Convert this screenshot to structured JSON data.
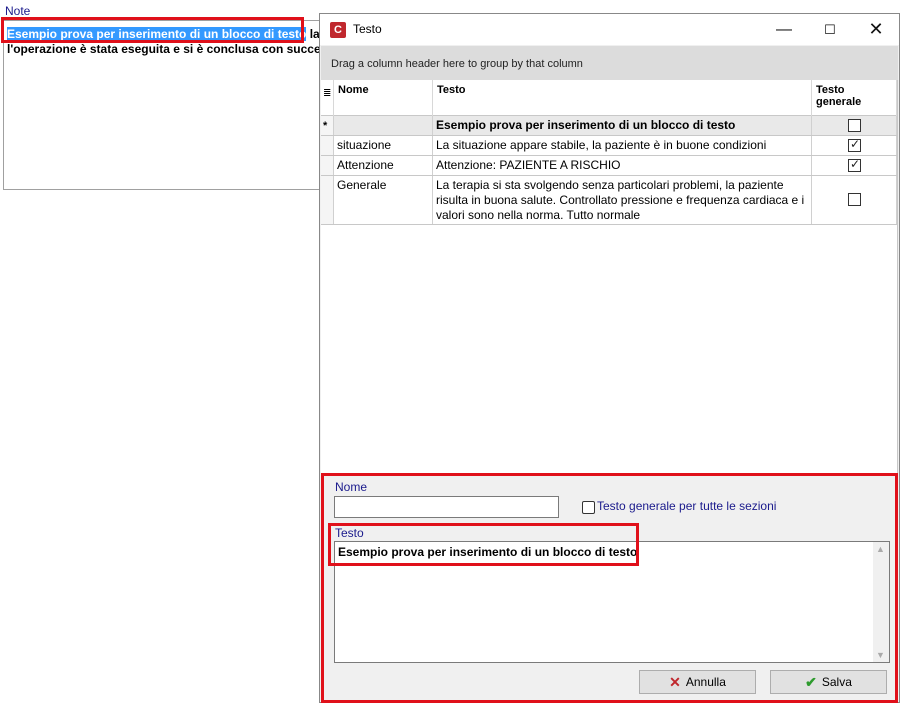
{
  "note": {
    "label": "Note",
    "line1_selected": "Esempio prova per inserimento di un blocco di testo",
    "line1_rest": " la",
    "line2": "l'operazione è stata eseguita e si è conclusa con succe"
  },
  "dialog": {
    "title": "Testo",
    "group_hint": "Drag a column header here to group by that column",
    "columns": {
      "nome": "Nome",
      "testo": "Testo",
      "generale": "Testo generale"
    },
    "new_row": {
      "indicator": "*",
      "nome": "",
      "testo": "Esempio prova per inserimento di un blocco di testo",
      "generale": false
    },
    "rows": [
      {
        "nome": "situazione",
        "testo": "La situazione appare stabile, la paziente è in buone condizioni",
        "generale": true
      },
      {
        "nome": "Attenzione",
        "testo": "Attenzione: PAZIENTE A RISCHIO",
        "generale": true
      },
      {
        "nome": "Generale",
        "testo": "La terapia si sta svolgendo senza particolari problemi, la paziente risulta in buona salute. Controllato pressione e frequenza cardiaca e i valori sono nella norma. Tutto normale",
        "generale": false
      }
    ],
    "edit": {
      "nome_label": "Nome",
      "nome_value": "",
      "generale_label": "Testo generale per tutte le sezioni",
      "generale_checked": false,
      "testo_label": "Testo",
      "testo_value": "Esempio prova per inserimento di un blocco di testo"
    },
    "buttons": {
      "cancel": "Annulla",
      "save": "Salva"
    }
  }
}
